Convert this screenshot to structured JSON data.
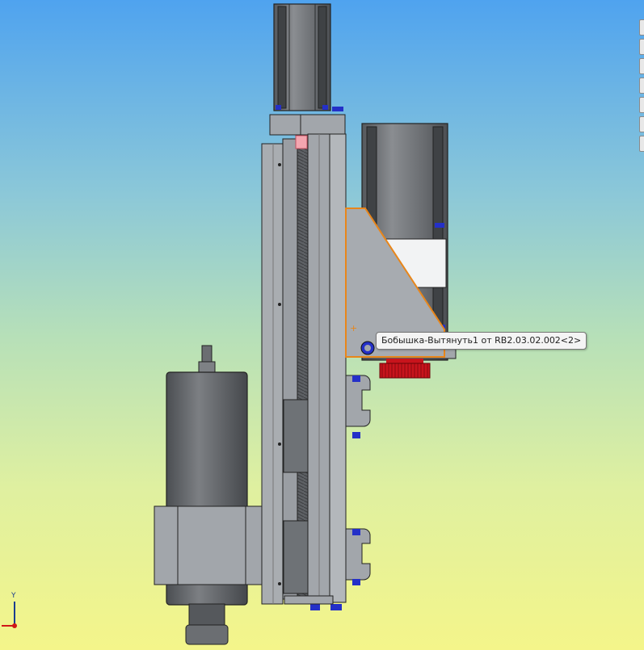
{
  "viewport": {
    "background_top": "#4fa3ef",
    "background_bottom": "#f4f58a"
  },
  "colors": {
    "part_gray": "#a2a6ab",
    "motor_dark": "#6b6e72",
    "selected_outline": "#e8861a",
    "fastener_blue": "#2430c8",
    "gear_red": "#c8141c",
    "highlight_pink": "#f4a6b0"
  },
  "tooltip": {
    "text": "Бобышка-Вытянуть1 от RB2.03.02.002<2>"
  },
  "triad": {
    "y_label": "Y",
    "x_color": "#d01818",
    "y_color": "#1b3d8f"
  },
  "right_toolbar": {
    "buttons": [
      "view-tool-1",
      "view-tool-2",
      "view-tool-3",
      "view-tool-4",
      "view-tool-5",
      "view-tool-6",
      "view-tool-7"
    ]
  }
}
